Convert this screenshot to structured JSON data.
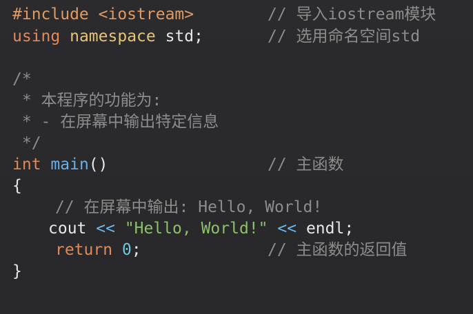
{
  "code": {
    "line1": {
      "directive": "#include",
      "header": "<iostream>",
      "comment": "// 导入iostream模块"
    },
    "line2": {
      "kw_using": "using",
      "kw_namespace": "namespace",
      "ns": "std",
      "semicolon": ";",
      "comment": "// 选用命名空间std"
    },
    "block_comment": {
      "open": "/*",
      "l1": " * 本程序的功能为:",
      "l2": " * - 在屏幕中输出特定信息",
      "close": " */"
    },
    "main_sig": {
      "type": "int",
      "name": "main",
      "parens": "()",
      "comment": "// 主函数"
    },
    "brace_open": "{",
    "inner_comment": "// 在屏幕中输出: Hello, World!",
    "cout_line": {
      "cout": "cout",
      "op1": "<<",
      "string": "\"Hello, World!\"",
      "op2": "<<",
      "endl": "endl;"
    },
    "return_line": {
      "kw": "return",
      "value": "0",
      "semicolon": ";",
      "comment": "// 主函数的返回值"
    },
    "brace_close": "}"
  }
}
